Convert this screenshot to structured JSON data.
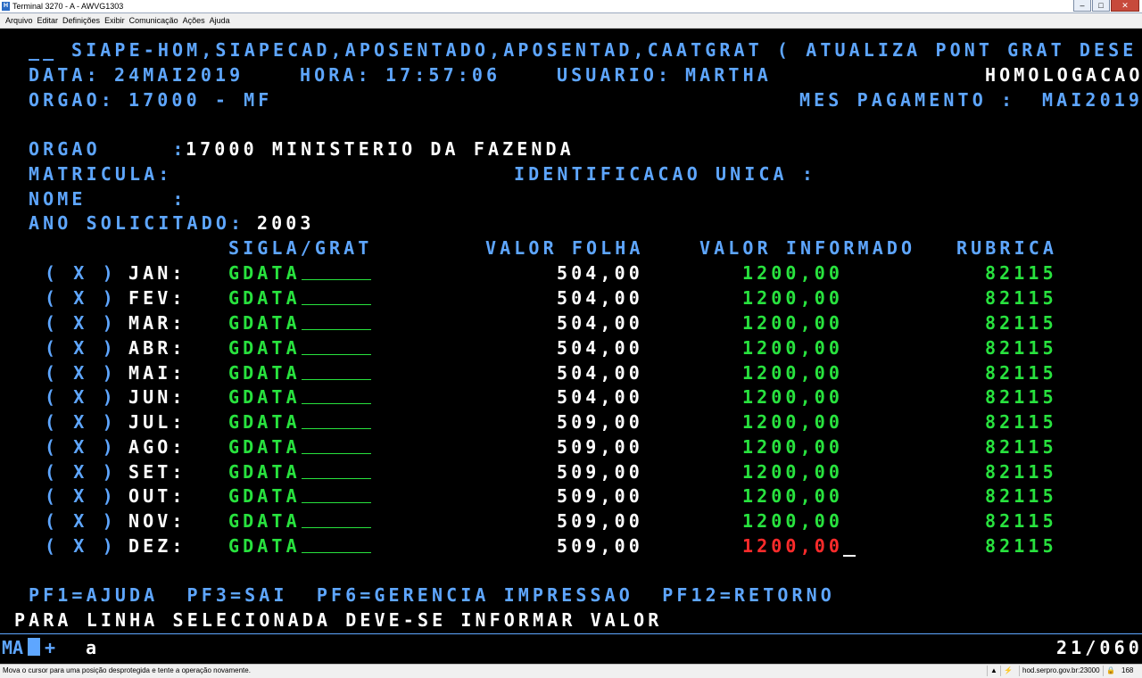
{
  "window": {
    "title": "Terminal 3270 - A - AWVG1303",
    "controls": {
      "minimize": "–",
      "maximize": "□",
      "close": "✕"
    }
  },
  "menu": [
    "Arquivo",
    "Editar",
    "Definições",
    "Exibir",
    "Comunicação",
    "Ações",
    "Ajuda"
  ],
  "header": {
    "line1_prefix": "__",
    "line1": "SIAPE-HOM,SIAPECAD,APOSENTADO,APOSENTAD,CAATGRAT ( ATUALIZA PONT GRAT DESE",
    "data_label": "DATA:",
    "data_value": "24MAI2019",
    "hora_label": "HORA:",
    "hora_value": "17:57:06",
    "usuario_label": "USUARIO:",
    "usuario_value": "MARTHA",
    "env": "HOMOLOGACAO",
    "orgao_label": "ORGAO:",
    "orgao_value": "17000 - MF",
    "mes_label": "MES PAGAMENTO :",
    "mes_value": "MAI2019"
  },
  "form": {
    "orgao_label": "ORGAO     :",
    "orgao_value": "17000 MINISTERIO DA FAZENDA",
    "matricula_label": "MATRICULA:",
    "identificacao_label": "IDENTIFICACAO UNICA :",
    "nome_label": "NOME      :",
    "ano_label": "ANO SOLICITADO:",
    "ano_value": "2003"
  },
  "table": {
    "headers": {
      "sigla": "SIGLA/GRAT",
      "folha": "VALOR FOLHA",
      "informado": "VALOR INFORMADO",
      "rubrica": "RUBRICA"
    },
    "rows": [
      {
        "sel": "( X )",
        "mes": "JAN:",
        "sigla": "GDATA",
        "folha": "504,00",
        "informado": "1200,00",
        "rubrica": "82115"
      },
      {
        "sel": "( X )",
        "mes": "FEV:",
        "sigla": "GDATA",
        "folha": "504,00",
        "informado": "1200,00",
        "rubrica": "82115"
      },
      {
        "sel": "( X )",
        "mes": "MAR:",
        "sigla": "GDATA",
        "folha": "504,00",
        "informado": "1200,00",
        "rubrica": "82115"
      },
      {
        "sel": "( X )",
        "mes": "ABR:",
        "sigla": "GDATA",
        "folha": "504,00",
        "informado": "1200,00",
        "rubrica": "82115"
      },
      {
        "sel": "( X )",
        "mes": "MAI:",
        "sigla": "GDATA",
        "folha": "504,00",
        "informado": "1200,00",
        "rubrica": "82115"
      },
      {
        "sel": "( X )",
        "mes": "JUN:",
        "sigla": "GDATA",
        "folha": "504,00",
        "informado": "1200,00",
        "rubrica": "82115"
      },
      {
        "sel": "( X )",
        "mes": "JUL:",
        "sigla": "GDATA",
        "folha": "509,00",
        "informado": "1200,00",
        "rubrica": "82115"
      },
      {
        "sel": "( X )",
        "mes": "AGO:",
        "sigla": "GDATA",
        "folha": "509,00",
        "informado": "1200,00",
        "rubrica": "82115"
      },
      {
        "sel": "( X )",
        "mes": "SET:",
        "sigla": "GDATA",
        "folha": "509,00",
        "informado": "1200,00",
        "rubrica": "82115"
      },
      {
        "sel": "( X )",
        "mes": "OUT:",
        "sigla": "GDATA",
        "folha": "509,00",
        "informado": "1200,00",
        "rubrica": "82115"
      },
      {
        "sel": "( X )",
        "mes": "NOV:",
        "sigla": "GDATA",
        "folha": "509,00",
        "informado": "1200,00",
        "rubrica": "82115"
      },
      {
        "sel": "( X )",
        "mes": "DEZ:",
        "sigla": "GDATA",
        "folha": "509,00",
        "informado": "1200,00",
        "rubrica": "82115",
        "error": true
      }
    ]
  },
  "footer": {
    "pfkeys": "PF1=AJUDA  PF3=SAI  PF6=GERENCIA IMPRESSAO  PF12=RETORNO",
    "message": "PARA LINHA SELECIONADA DEVE-SE INFORMAR VALOR"
  },
  "oia": {
    "left": "MA",
    "box_char": "",
    "plus": "+",
    "a": "a",
    "cursor_pos": "21/060"
  },
  "statusbar": {
    "message": "Mova o cursor para uma posição desprotegida e tente a operação novamente.",
    "host": "hod.serpro.gov.br:23000",
    "port": "168"
  },
  "colors": {
    "field_label": "#5ea6ff",
    "protected_value": "#ffffff",
    "input_value": "#28e23e",
    "error_value": "#ff2b2b"
  }
}
